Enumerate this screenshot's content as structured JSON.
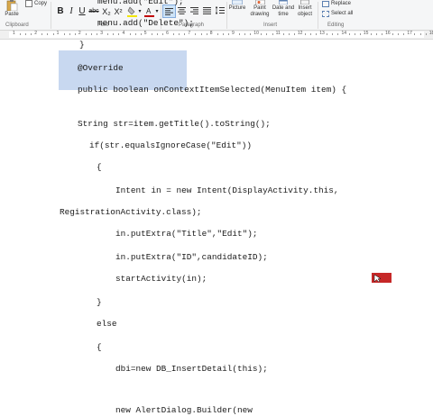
{
  "ribbon": {
    "paste_label": "Paste",
    "copy_label": "Copy",
    "groups": {
      "clipboard": "Clipboard",
      "font": "Font",
      "paragraph": "Paragraph",
      "insert": "Insert",
      "editing": "Editing"
    },
    "format_buttons": {
      "bold": "B",
      "italic": "I",
      "underline": "U",
      "strike": "abc",
      "subscript": "X₂",
      "superscript": "X²"
    },
    "insert_buttons": {
      "picture": "Picture",
      "paint_drawing": "Paint drawing",
      "date_time": "Date and time",
      "insert_object": "Insert object"
    },
    "editing_buttons": {
      "replace": "Replace",
      "select_all": "Select all"
    }
  },
  "ruler": {
    "numbers": [
      "1",
      "2",
      "1",
      "2",
      "3",
      "4",
      "5",
      "6",
      "7",
      "8",
      "9",
      "10",
      "11",
      "12",
      "13",
      "14",
      "15",
      "16",
      "17",
      "18"
    ]
  },
  "document": {
    "lines": [
      "menu.add(\"Edit\");",
      "menu.add(\"Delete\");",
      "}",
      "",
      "@Override",
      "public boolean onContextItemSelected(MenuItem item) {",
      "",
      "String str=item.getTitle().toString();",
      "  if(str.equalsIgnoreCase(\"Edit\"))",
      "  {",
      "        Intent in = new Intent(DisplayActivity.this,",
      "RegistrationActivity.class);",
      "        in.putExtra(\"Title\",\"Edit\");",
      "        in.putExtra(\"ID\",candidateID);",
      "        startActivity(in);",
      "",
      "  }",
      "  else",
      "  {",
      "        dbi=new DB_InsertDetail(this);",
      "",
      "        new AlertDialog.Builder(new"
    ]
  },
  "colors": {
    "selection": "#c8d8f0",
    "ribbon_bg": "#f5f6f7",
    "highlight_btn": "#cde3f7"
  }
}
